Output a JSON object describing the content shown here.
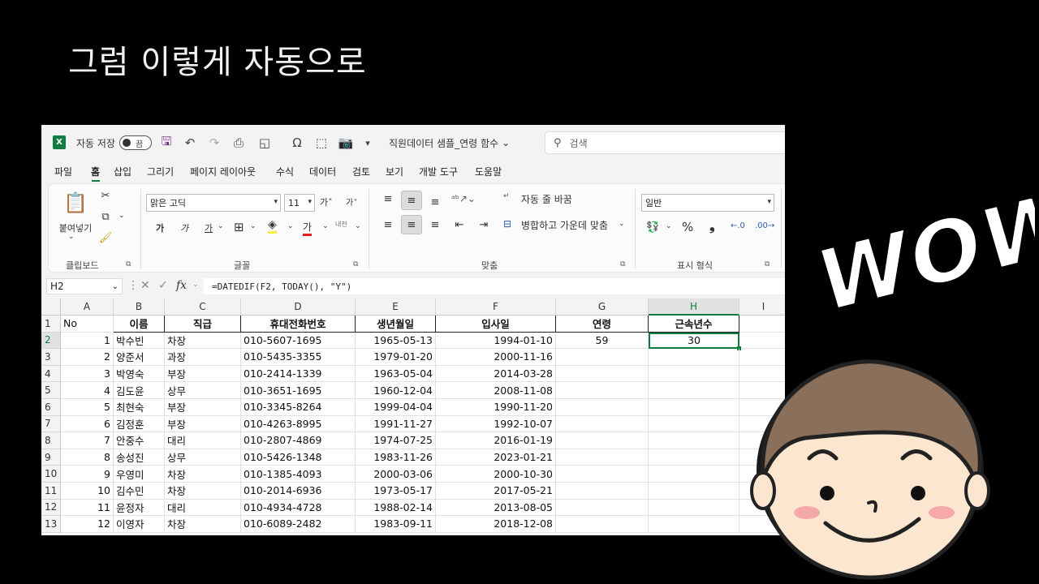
{
  "slide_title": "그럼 이렇게 자동으로",
  "excel": {
    "logo": "X",
    "autosave_label": "자동 저장",
    "autosave_state": "끔",
    "file_title": "직원데이터 샘플_연령 함수",
    "file_title_arrow": "⌄",
    "search_placeholder": "검색",
    "menu": [
      "파일",
      "홈",
      "삽입",
      "그리기",
      "페이지 레이아웃",
      "수식",
      "데이터",
      "검토",
      "보기",
      "개발 도구",
      "도움말"
    ],
    "ribbon": {
      "clipboard": {
        "label": "클립보드",
        "paste": "붙여넣기"
      },
      "font": {
        "label": "글꼴",
        "font_name": "맑은 고딕",
        "font_size": "11",
        "grow": "가˄",
        "shrink": "가˅",
        "bold": "가",
        "italic": "가",
        "underline": "가",
        "font_color": "가",
        "phonetic": "내천"
      },
      "alignment": {
        "label": "맞춤",
        "wrap": "자동 줄 바꿈",
        "merge": "병합하고 가운데 맞춤"
      },
      "number": {
        "label": "표시 형식",
        "format": "일반",
        "percent": "%",
        "comma": "❟"
      }
    },
    "namebox": "H2",
    "fx": "fx",
    "formula": "=DATEDIF(F2, TODAY(), \"Y\")",
    "columns": [
      "A",
      "B",
      "C",
      "D",
      "E",
      "F",
      "G",
      "H",
      "I"
    ],
    "headers": [
      "No",
      "이름",
      "직급",
      "휴대전화번호",
      "생년월일",
      "입사일",
      "연령",
      "근속년수"
    ],
    "rows": [
      {
        "n": "1",
        "no": "1",
        "name": "박수빈",
        "rank": "차장",
        "phone": "010-5607-1695",
        "birth": "1965-05-13",
        "join": "1994-01-10",
        "age": "59",
        "tenure": "30"
      },
      {
        "n": "3",
        "no": "2",
        "name": "양준서",
        "rank": "과장",
        "phone": "010-5435-3355",
        "birth": "1979-01-20",
        "join": "2000-11-16",
        "age": "",
        "tenure": ""
      },
      {
        "n": "4",
        "no": "3",
        "name": "박영숙",
        "rank": "부장",
        "phone": "010-2414-1339",
        "birth": "1963-05-04",
        "join": "2014-03-28",
        "age": "",
        "tenure": ""
      },
      {
        "n": "5",
        "no": "4",
        "name": "김도윤",
        "rank": "상무",
        "phone": "010-3651-1695",
        "birth": "1960-12-04",
        "join": "2008-11-08",
        "age": "",
        "tenure": ""
      },
      {
        "n": "6",
        "no": "5",
        "name": "최현숙",
        "rank": "부장",
        "phone": "010-3345-8264",
        "birth": "1999-04-04",
        "join": "1990-11-20",
        "age": "",
        "tenure": ""
      },
      {
        "n": "7",
        "no": "6",
        "name": "김정훈",
        "rank": "부장",
        "phone": "010-4263-8995",
        "birth": "1991-11-27",
        "join": "1992-10-07",
        "age": "",
        "tenure": ""
      },
      {
        "n": "8",
        "no": "7",
        "name": "안중수",
        "rank": "대리",
        "phone": "010-2807-4869",
        "birth": "1974-07-25",
        "join": "2016-01-19",
        "age": "",
        "tenure": ""
      },
      {
        "n": "9",
        "no": "8",
        "name": "송성진",
        "rank": "상무",
        "phone": "010-5426-1348",
        "birth": "1983-11-26",
        "join": "2023-01-21",
        "age": "",
        "tenure": ""
      },
      {
        "n": "10",
        "no": "9",
        "name": "우영미",
        "rank": "차장",
        "phone": "010-1385-4093",
        "birth": "2000-03-06",
        "join": "2000-10-30",
        "age": "",
        "tenure": ""
      },
      {
        "n": "11",
        "no": "10",
        "name": "김수민",
        "rank": "차장",
        "phone": "010-2014-6936",
        "birth": "1973-05-17",
        "join": "2017-05-21",
        "age": "",
        "tenure": ""
      },
      {
        "n": "12",
        "no": "11",
        "name": "윤정자",
        "rank": "대리",
        "phone": "010-4934-4728",
        "birth": "1988-02-14",
        "join": "2013-08-05",
        "age": "",
        "tenure": ""
      },
      {
        "n": "13",
        "no": "12",
        "name": "이영자",
        "rank": "차장",
        "phone": "010-6089-2482",
        "birth": "1983-09-11",
        "join": "2018-12-08",
        "age": "",
        "tenure": ""
      }
    ],
    "header_row_number": "1",
    "first_data_row_number": "2"
  },
  "wow_text": "WOW",
  "colors": {
    "excel_green": "#107c41",
    "background": "#000000",
    "face_skin": "#fde6cf",
    "hair": "#8a6f5a",
    "blush": "#f4a9a8"
  }
}
